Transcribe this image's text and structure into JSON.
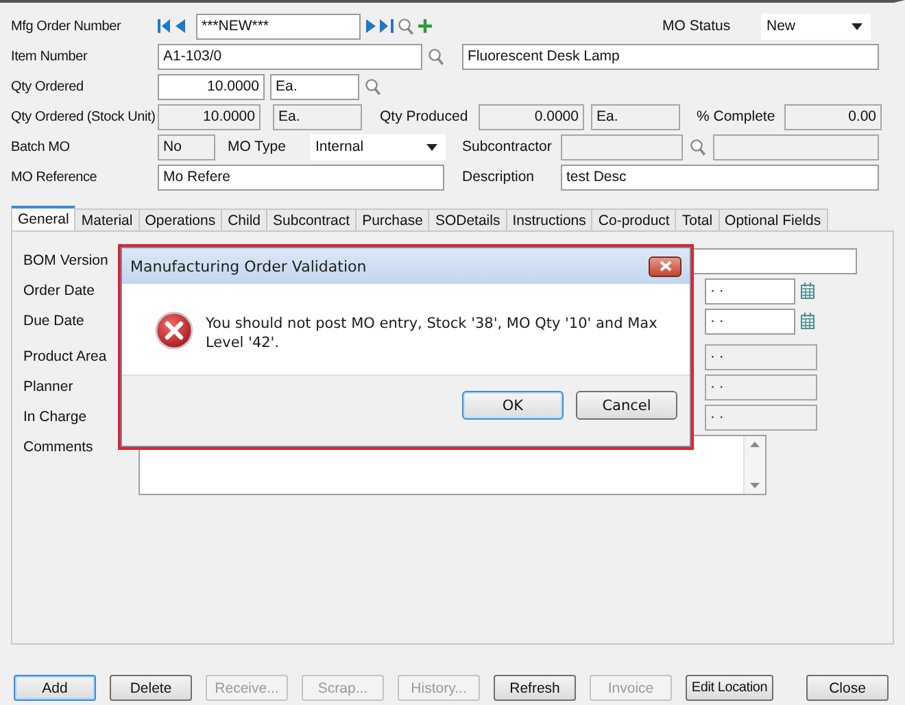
{
  "form": {
    "mfg_order_number": {
      "label": "Mfg Order Number",
      "value": "***NEW***"
    },
    "mo_status": {
      "label": "MO Status",
      "value": "New"
    },
    "item_number": {
      "label": "Item Number",
      "value": "A1-103/0",
      "description": "Fluorescent Desk Lamp"
    },
    "qty_ordered": {
      "label": "Qty Ordered",
      "value": "10.0000",
      "unit": "Ea."
    },
    "qty_stock": {
      "label": "Qty Ordered (Stock Unit)",
      "value": "10.0000",
      "unit": "Ea.",
      "disabled": true
    },
    "qty_produced": {
      "label": "Qty Produced",
      "value": "0.0000",
      "unit": "Ea.",
      "disabled": true
    },
    "percent_complete": {
      "label": "% Complete",
      "value": "0.00",
      "disabled": true
    },
    "batch_mo": {
      "label": "Batch MO",
      "value": "No",
      "disabled": true
    },
    "mo_type": {
      "label": "MO Type",
      "value": "Internal"
    },
    "subcontractor": {
      "label": "Subcontractor",
      "disabled": true
    },
    "mo_reference": {
      "label": "MO Reference",
      "value": "Mo Refere"
    },
    "description": {
      "label": "Description",
      "value": "test Desc"
    }
  },
  "tabs": [
    {
      "label": "General",
      "selected": true
    },
    {
      "label": "Material",
      "selected": false
    },
    {
      "label": "Operations",
      "selected": false
    },
    {
      "label": "Child",
      "selected": false
    },
    {
      "label": "Subcontract",
      "selected": false
    },
    {
      "label": "Purchase",
      "selected": false
    },
    {
      "label": "SODetails",
      "selected": false
    },
    {
      "label": "Instructions",
      "selected": false
    },
    {
      "label": "Co-product",
      "selected": false
    },
    {
      "label": "Total",
      "selected": false
    },
    {
      "label": "Optional Fields",
      "selected": false
    }
  ],
  "general": {
    "bom_version": {
      "label": "BOM Version"
    },
    "order_date": {
      "label": "Order Date",
      "value": "·  ·"
    },
    "due_date": {
      "label": "Due Date",
      "value": "·  ·"
    },
    "product_area": {
      "label": "Product Area",
      "value": "·  ·",
      "disabled": true
    },
    "planner": {
      "label": "Planner",
      "value": "·  ·",
      "disabled": true
    },
    "in_charge": {
      "label": "In Charge",
      "value": "·  ·",
      "disabled": true
    },
    "comments": {
      "label": "Comments"
    }
  },
  "dialog": {
    "title": "Manufacturing Order Validation",
    "message": "You should not post MO entry, Stock '38', MO Qty '10' and Max Level '42'.",
    "buttons": [
      {
        "label": "OK",
        "default": true
      },
      {
        "label": "Cancel",
        "default": false
      }
    ]
  },
  "buttons": [
    {
      "label": "Add",
      "disabled": false,
      "focused": true
    },
    {
      "label": "Delete",
      "disabled": false,
      "focused": false
    },
    {
      "label": "Receive...",
      "disabled": true,
      "focused": false
    },
    {
      "label": "Scrap...",
      "disabled": true,
      "focused": false
    },
    {
      "label": "History...",
      "disabled": true,
      "focused": false
    },
    {
      "label": "Refresh",
      "disabled": false,
      "focused": false
    },
    {
      "label": "Invoice",
      "disabled": true,
      "focused": false
    },
    {
      "label": "Edit Location",
      "disabled": false,
      "focused": false
    },
    {
      "label": "Close",
      "disabled": false,
      "focused": false
    }
  ]
}
